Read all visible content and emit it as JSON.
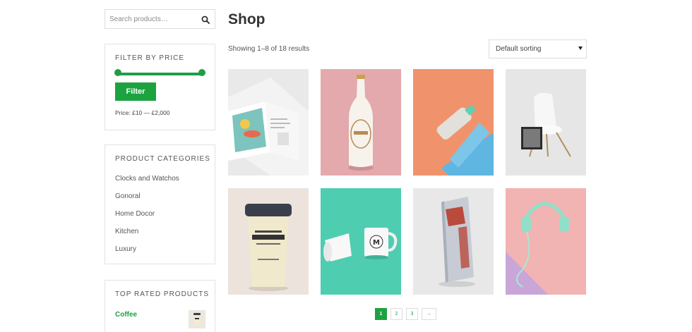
{
  "sidebar": {
    "search": {
      "placeholder": "Search products…"
    },
    "price_filter": {
      "title": "FILTER BY PRICE",
      "button_label": "Filter",
      "price_text": "Price: £10 — £2,000"
    },
    "categories": {
      "title": "PRODUCT CATEGORIES",
      "items": [
        "Clocks and Watchos",
        "Gonoral",
        "Home Docor",
        "Kitchen",
        "Luxury"
      ]
    },
    "top_rated": {
      "title": "TOP RATED PRODUCTS",
      "items": [
        {
          "name": "Coffee"
        }
      ]
    }
  },
  "main": {
    "title": "Shop",
    "result_count": "Showing 1–8 of 18 results",
    "sorting": {
      "selected": "Default sorting"
    },
    "products": [
      {
        "icon": "book-mockup"
      },
      {
        "icon": "bottle-mockup"
      },
      {
        "icon": "glass-bottle-mockup"
      },
      {
        "icon": "chair-mockup"
      },
      {
        "icon": "coffee-cup-mockup"
      },
      {
        "icon": "mugs-mockup"
      },
      {
        "icon": "coffee-bag-mockup"
      },
      {
        "icon": "headphones-mockup"
      }
    ],
    "pagination": {
      "pages": [
        "1",
        "2",
        "3"
      ],
      "current": "1",
      "next": "→"
    }
  },
  "colors": {
    "accent": "#1ca340",
    "border": "#e2e2e2",
    "text": "#333333"
  }
}
